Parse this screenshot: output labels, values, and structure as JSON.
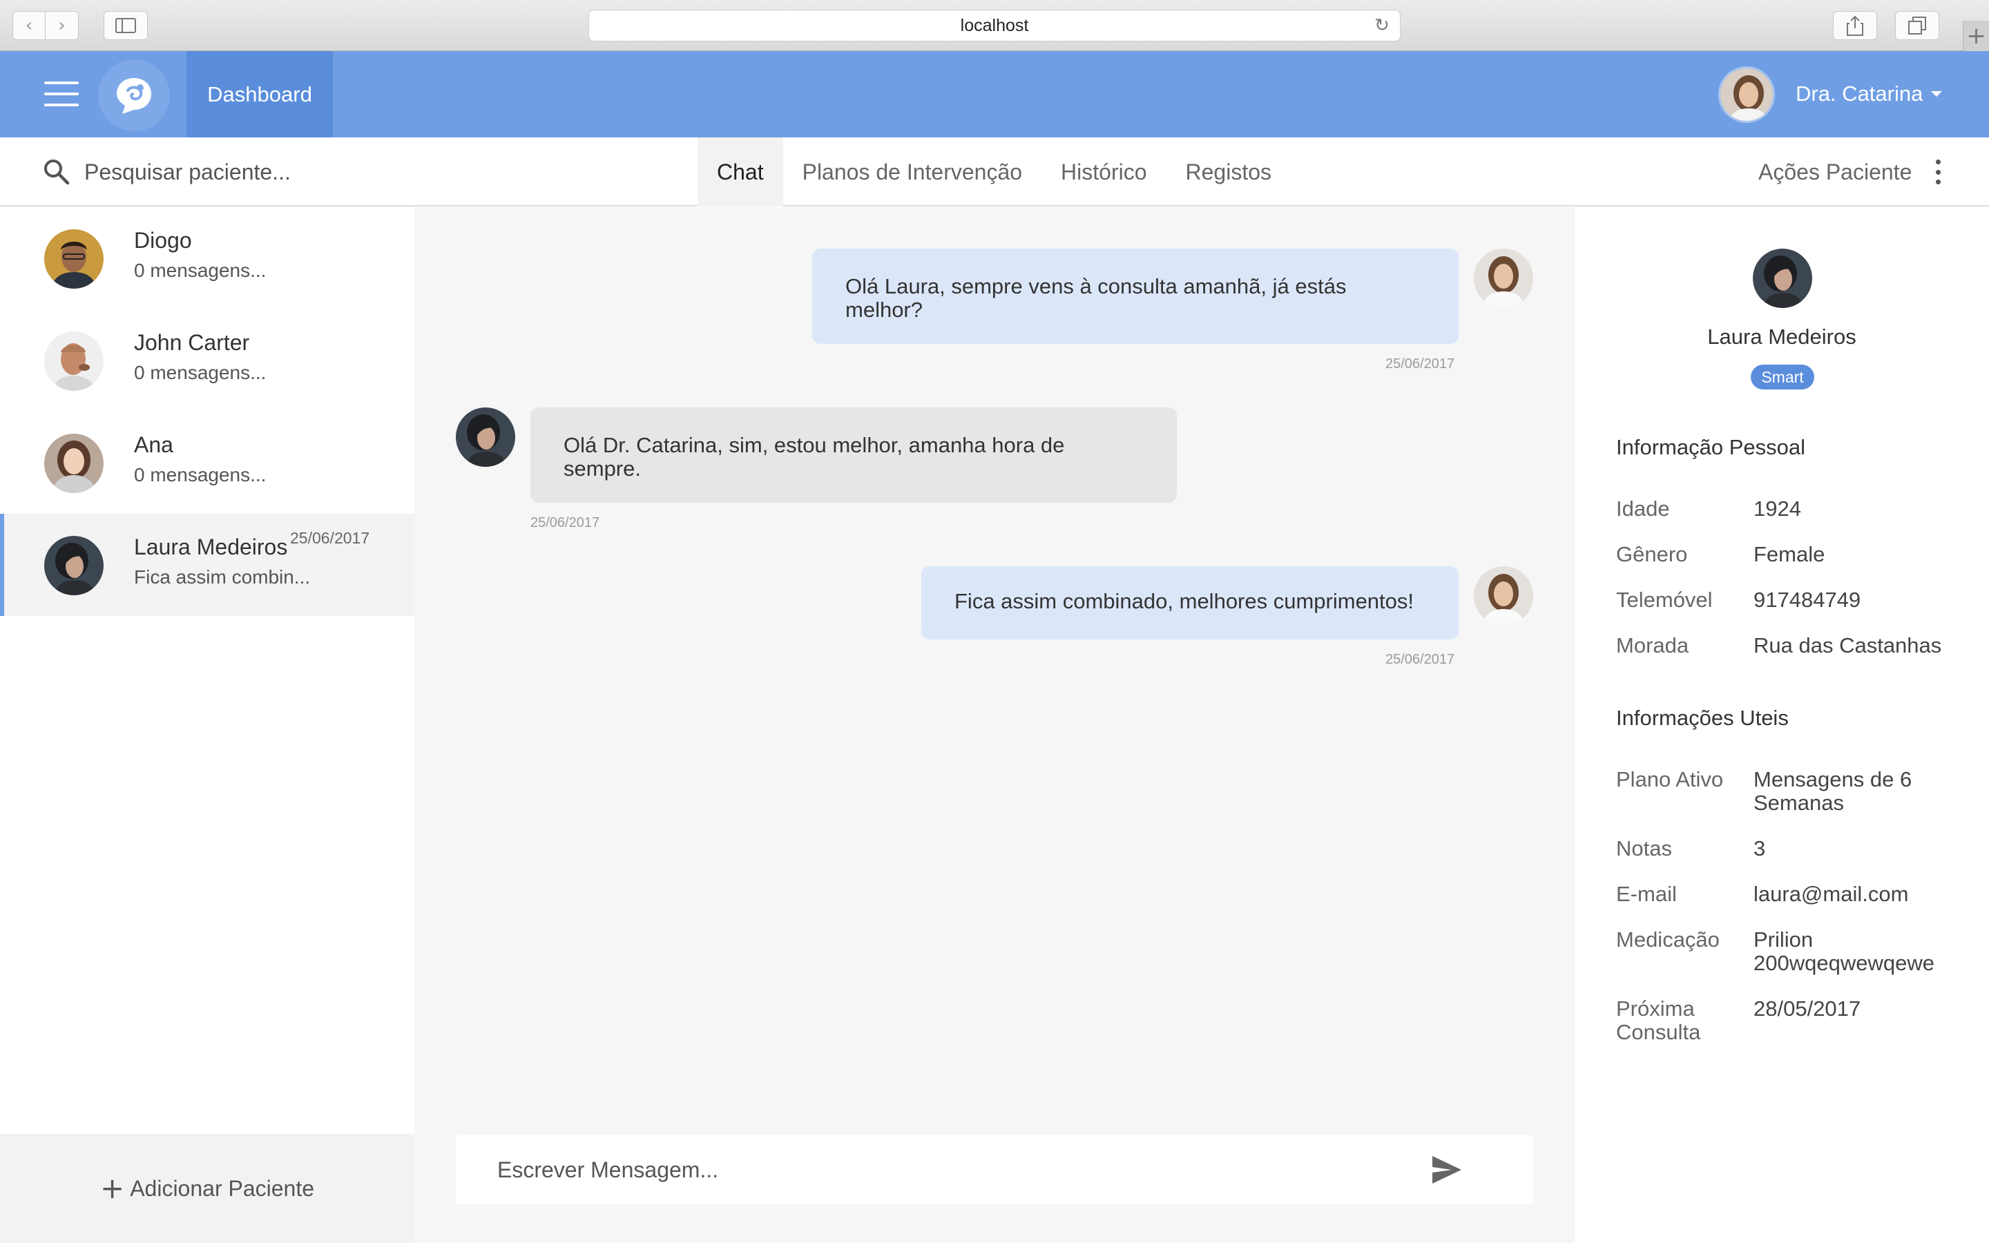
{
  "browser": {
    "url": "localhost"
  },
  "header": {
    "dashboard_label": "Dashboard",
    "user_name": "Dra. Catarina"
  },
  "subbar": {
    "search_placeholder": "Pesquisar paciente...",
    "tabs": [
      {
        "label": "Chat",
        "active": true
      },
      {
        "label": "Planos de Intervenção",
        "active": false
      },
      {
        "label": "Histórico",
        "active": false
      },
      {
        "label": "Registos",
        "active": false
      }
    ],
    "actions_label": "Ações Paciente"
  },
  "patients": [
    {
      "name": "Diogo",
      "subtitle": "0 mensagens...",
      "date": ""
    },
    {
      "name": "John Carter",
      "subtitle": "0 mensagens...",
      "date": ""
    },
    {
      "name": "Ana",
      "subtitle": "0 mensagens...",
      "date": ""
    },
    {
      "name": "Laura Medeiros",
      "subtitle": "Fica assim combin...",
      "date": "25/06/2017",
      "active": true
    }
  ],
  "add_patient_label": "Adicionar Paciente",
  "messages": [
    {
      "direction": "out",
      "text": "Olá Laura, sempre vens à consulta amanhã, já estás melhor?",
      "time": "25/06/2017"
    },
    {
      "direction": "in",
      "text": "Olá Dr. Catarina, sim, estou melhor, amanha hora de sempre.",
      "time": "25/06/2017"
    },
    {
      "direction": "out",
      "text": "Fica assim combinado, melhores cumprimentos!",
      "time": "25/06/2017"
    }
  ],
  "compose": {
    "placeholder": "Escrever Mensagem..."
  },
  "patient_info": {
    "name": "Laura Medeiros",
    "badge": "Smart",
    "personal_title": "Informação Pessoal",
    "personal": [
      {
        "label": "Idade",
        "value": "1924"
      },
      {
        "label": "Gênero",
        "value": "Female"
      },
      {
        "label": "Telemóvel",
        "value": "917484749"
      },
      {
        "label": "Morada",
        "value": "Rua das Castanhas"
      }
    ],
    "useful_title": "Informações Uteis",
    "useful": [
      {
        "label": "Plano Ativo",
        "value": "Mensagens de 6 Semanas"
      },
      {
        "label": "Notas",
        "value": "3"
      },
      {
        "label": "E-mail",
        "value": "laura@mail.com"
      },
      {
        "label": "Medicação",
        "value": "Prilion 200wqeqwewqewe"
      },
      {
        "label": "Próxima Consulta",
        "value": "28/05/2017"
      }
    ]
  },
  "colors": {
    "header": "#6f9ee4",
    "header_active": "#5a8ddb",
    "bubble_out": "#dbe7f9",
    "bubble_in": "#e6e6e6",
    "badge": "#5a8ddb"
  }
}
